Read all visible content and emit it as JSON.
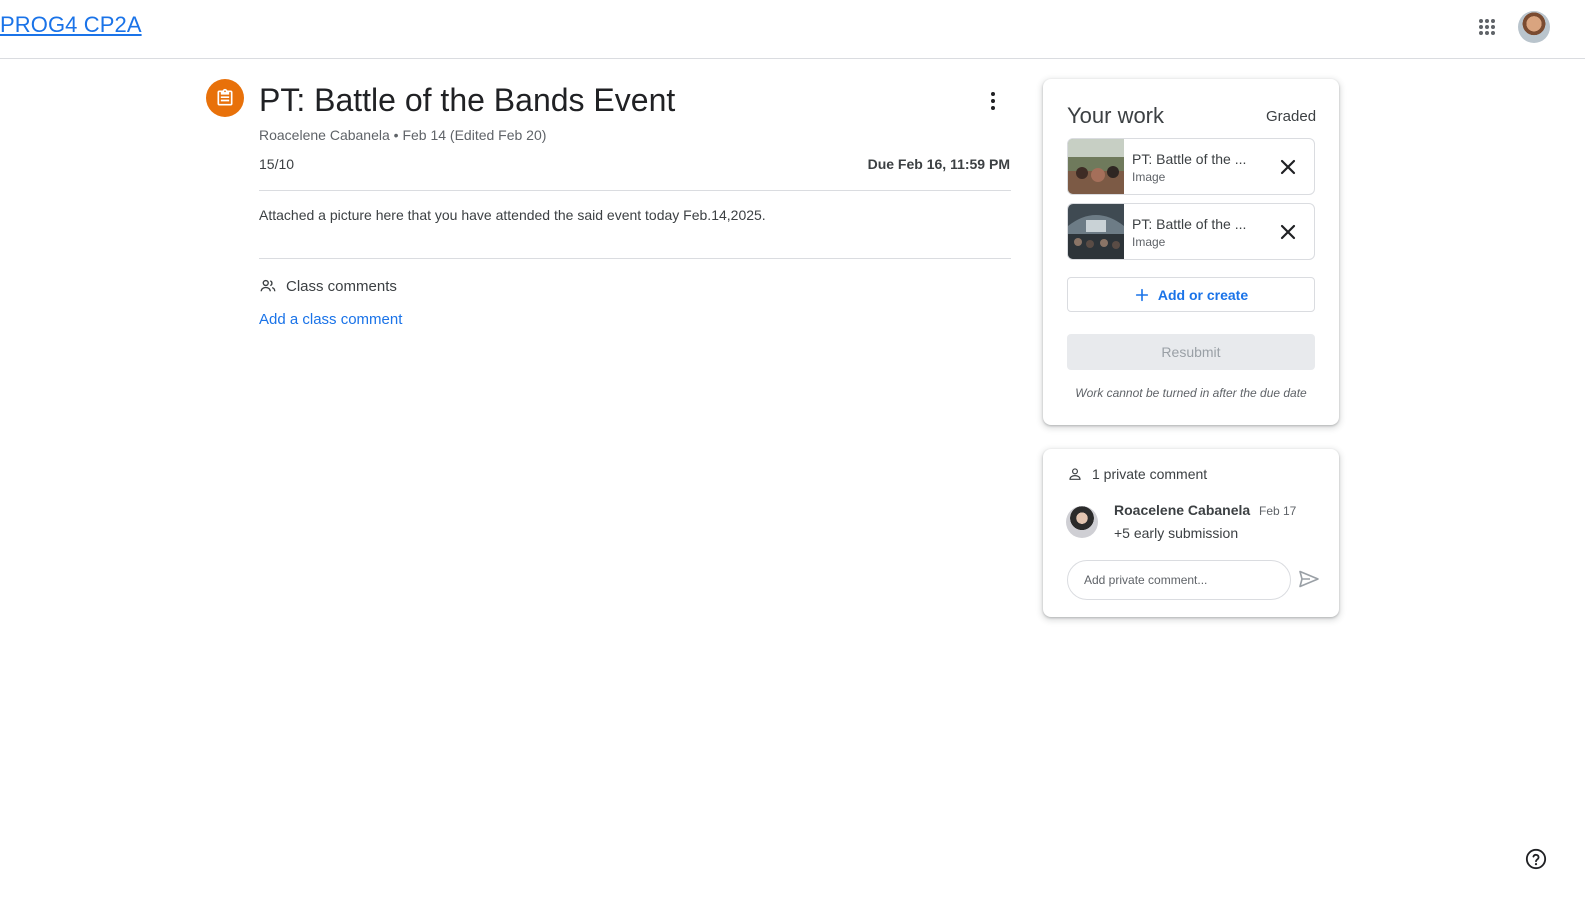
{
  "header": {
    "course_name": "PROG4 CP2A",
    "apps_icon": "google-apps-grid-icon",
    "account_avatar": "user-avatar"
  },
  "assignment": {
    "icon": "assignment-clipboard-icon",
    "title": "PT: Battle of the Bands Event",
    "meta": "Roacelene Cabanela • Feb 14 (Edited Feb 20)",
    "points": "15/10",
    "due": "Due Feb 16, 11:59 PM",
    "description": "Attached a picture here that you have attended the said event today Feb.14,2025.",
    "class_comments_label": "Class comments",
    "add_class_comment": "Add a class comment"
  },
  "your_work": {
    "title": "Your work",
    "status": "Graded",
    "attachments": [
      {
        "title": "PT: Battle of the ...",
        "type": "Image"
      },
      {
        "title": "PT: Battle of the ...",
        "type": "Image"
      }
    ],
    "add_or_create": "Add or create",
    "resubmit": "Resubmit",
    "note": "Work cannot be turned in after the due date"
  },
  "private_comments": {
    "header": "1 private comment",
    "comments": [
      {
        "author": "Roacelene Cabanela",
        "date": "Feb 17",
        "text": "+5 early submission"
      }
    ],
    "input_placeholder": "Add private comment..."
  },
  "colors": {
    "accent_blue": "#1a73e8",
    "assignment_orange": "#e8710a",
    "text_primary": "#3c4043",
    "text_secondary": "#5f6368",
    "divider": "#dadce0"
  }
}
